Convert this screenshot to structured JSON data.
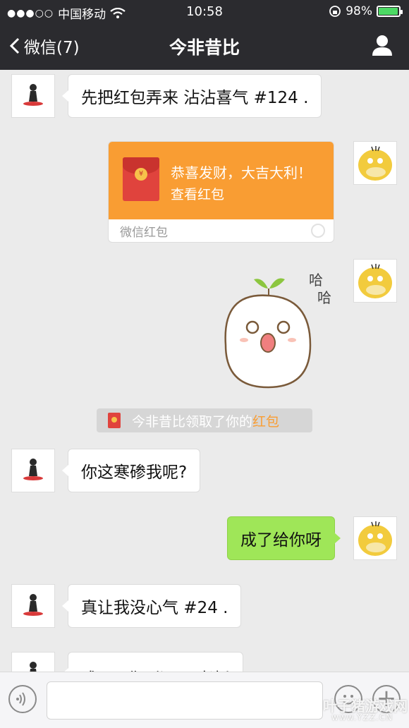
{
  "status_bar": {
    "signal_dots": "●●●○○",
    "carrier": "中国移动",
    "time": "10:58",
    "battery": "98%",
    "battery_level": 0.98
  },
  "nav": {
    "back_label": "微信(7)",
    "title": "今非昔比"
  },
  "messages": [
    {
      "side": "left",
      "text": "先把红包弄来 沾沾喜气 #124 ."
    },
    {
      "side": "right",
      "type": "red_packet",
      "title": "恭喜发财，大吉大利！",
      "sub": "查看红包",
      "footer": "微信红包"
    },
    {
      "side": "right",
      "type": "sticker",
      "sticker_text_1": "哈",
      "sticker_text_2": "哈"
    },
    {
      "type": "system",
      "text_prefix": "今非昔比领取了你的",
      "text_highlight": "红包"
    },
    {
      "side": "left",
      "text": "你这寒碜我呢?"
    },
    {
      "side": "right",
      "text": "成了给你呀"
    },
    {
      "side": "left",
      "text": "真让我没心气 #24 ."
    },
    {
      "side": "left",
      "text": "成了? 你别逗了 老板"
    }
  ],
  "watermark": {
    "line1": "叶子猪游戏网",
    "line2": "www.YZZ.CN"
  },
  "colors": {
    "nav_bg": "#2b2b2f",
    "chat_bg": "#ebebeb",
    "green_bubble": "#9fe658",
    "red_packet": "#f99d33",
    "battery": "#4cd964"
  }
}
